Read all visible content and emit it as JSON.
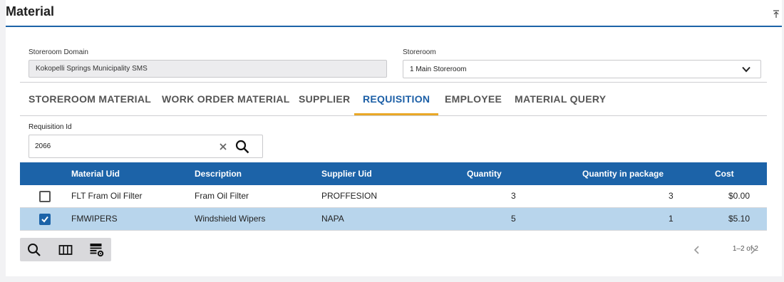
{
  "header": {
    "title": "Material"
  },
  "form": {
    "domain_label": "Storeroom Domain",
    "domain_value": "Kokopelli Springs Municipality SMS",
    "storeroom_label": "Storeroom",
    "storeroom_value": "1 Main Storeroom"
  },
  "tabs": [
    {
      "label": "STOREROOM MATERIAL",
      "active": false
    },
    {
      "label": "WORK ORDER MATERIAL",
      "active": false
    },
    {
      "label": "SUPPLIER",
      "active": false
    },
    {
      "label": "REQUISITION",
      "active": true
    },
    {
      "label": "EMPLOYEE",
      "active": false
    },
    {
      "label": "MATERIAL QUERY",
      "active": false
    }
  ],
  "search": {
    "label": "Requisition Id",
    "value": "2066"
  },
  "grid": {
    "columns": [
      "Material Uid",
      "Description",
      "Supplier Uid",
      "Quantity",
      "Quantity in package",
      "Cost"
    ],
    "rows": [
      {
        "selected": false,
        "material_uid": "FLT Fram Oil Filter",
        "description": "Fram Oil Filter",
        "supplier_uid": "PROFFESION",
        "quantity": "3",
        "quantity_in_package": "3",
        "cost": "$0.00"
      },
      {
        "selected": true,
        "material_uid": "FMWIPERS",
        "description": "Windshield Wipers",
        "supplier_uid": "NAPA",
        "quantity": "5",
        "quantity_in_package": "1",
        "cost": "$5.10"
      }
    ]
  },
  "pager": {
    "text": "1–2 of 2"
  },
  "colors": {
    "accent": "#1c63a8",
    "tab_underline": "#e9a826",
    "selected_row": "#b8d5ec"
  },
  "icons": {
    "collapse": "collapse-up-icon",
    "dropdown": "chevron-down-icon",
    "clear": "close-icon",
    "search": "search-icon",
    "toolbar": [
      "search-icon",
      "columns-icon",
      "table-settings-icon"
    ],
    "pager": [
      "chevron-left-icon",
      "chevron-right-icon"
    ]
  }
}
